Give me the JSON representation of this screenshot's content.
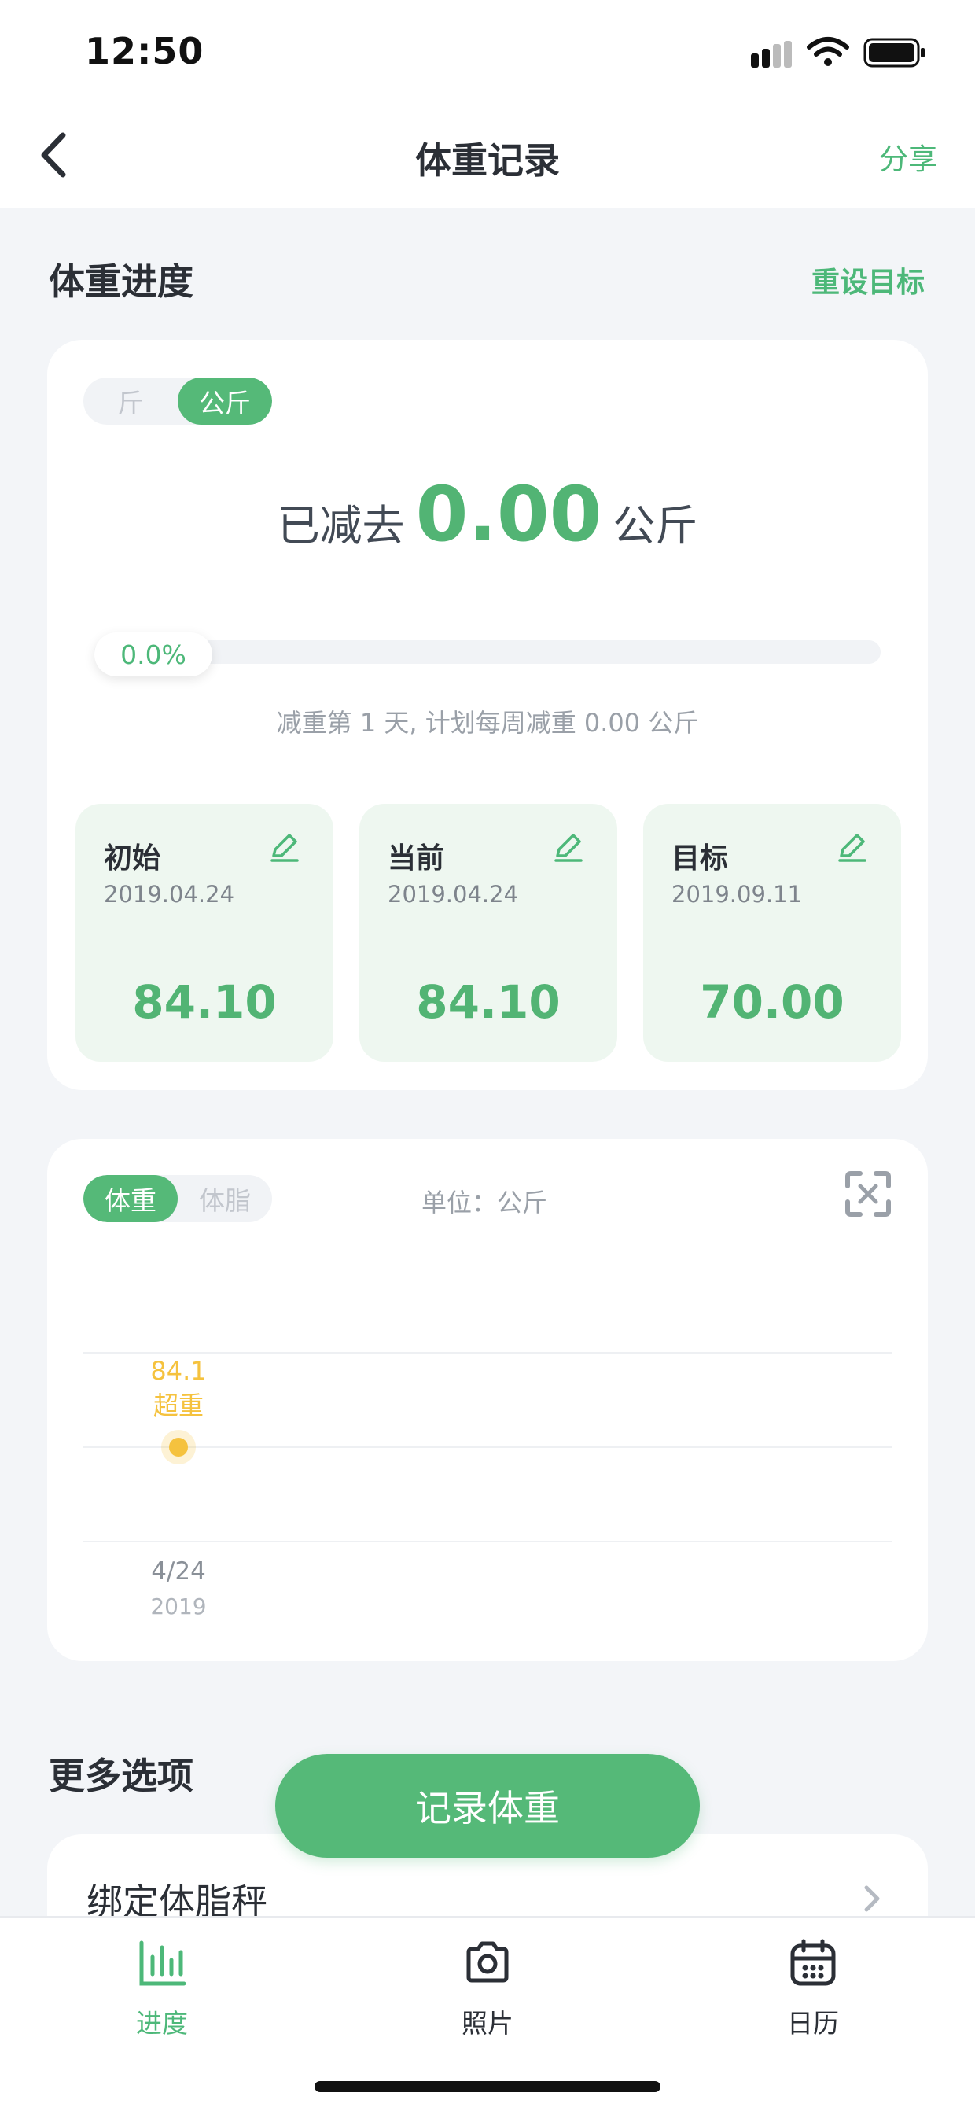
{
  "status": {
    "time": "12:50"
  },
  "nav": {
    "title": "体重记录",
    "share": "分享"
  },
  "progress_section": {
    "title": "体重进度",
    "reset_goal": "重设目标",
    "unit_toggle": {
      "options": [
        "斤",
        "公斤"
      ],
      "selected": "公斤"
    },
    "lost": {
      "label": "已减去",
      "value": "0.00",
      "unit": "公斤"
    },
    "progress": {
      "percent_text": "0.0%",
      "fraction": 0.0
    },
    "plan_text": "减重第 1 天, 计划每周减重 0.00 公斤",
    "stats": [
      {
        "label": "初始",
        "date": "2019.04.24",
        "value": "84.10"
      },
      {
        "label": "当前",
        "date": "2019.04.24",
        "value": "84.10"
      },
      {
        "label": "目标",
        "date": "2019.09.11",
        "value": "70.00"
      }
    ]
  },
  "chart_card": {
    "metric_toggle": {
      "options": [
        "体重",
        "体脂"
      ],
      "selected": "体重"
    },
    "unit_label": "单位：公斤"
  },
  "chart_data": {
    "type": "scatter",
    "x": [
      "4/24"
    ],
    "x_sublabels": [
      "2019"
    ],
    "series": [
      {
        "values": [
          84.1
        ],
        "point_labels": [
          "84.1"
        ],
        "status_labels": [
          "超重"
        ],
        "color": "#f5c23e"
      }
    ],
    "grid": true
  },
  "more": {
    "title": "更多选项",
    "options": [
      {
        "label": "绑定体脂秤"
      }
    ]
  },
  "record_button": "记录体重",
  "tabs": [
    {
      "label": "进度",
      "icon": "bar-chart-icon",
      "active": true
    },
    {
      "label": "照片",
      "icon": "camera-icon",
      "active": false
    },
    {
      "label": "日历",
      "icon": "calendar-icon",
      "active": false
    }
  ],
  "colors": {
    "accent": "#55b978",
    "overweight": "#f5c23e",
    "background": "#f3f5f8"
  }
}
